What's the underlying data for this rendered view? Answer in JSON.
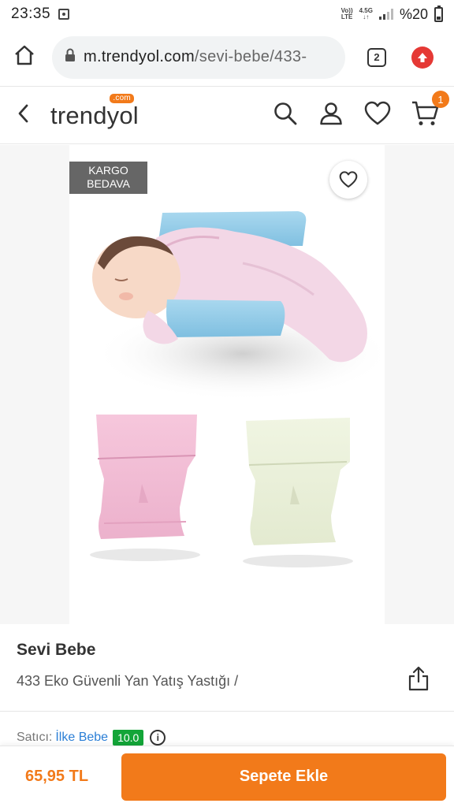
{
  "status_bar": {
    "time": "23:35",
    "network_top": "Vo))",
    "network_bottom": "LTE",
    "speed_top": "4.5G",
    "speed_bottom": "↓↑",
    "battery": "%20"
  },
  "browser": {
    "url_domain": "m.trendyol.com",
    "url_path": "/sevi-bebe/433-",
    "tab_count": "2"
  },
  "header": {
    "logo": "trendyol",
    "logo_suffix": ".com",
    "cart_count": "1"
  },
  "product": {
    "badge_line1": "KARGO",
    "badge_line2": "BEDAVA",
    "brand": "Sevi Bebe",
    "name": "433 Eko Güvenli Yan Yatış Yastığı /",
    "seller_label": "Satıcı:",
    "seller_name": "İlke Bebe",
    "seller_score": "10.0",
    "info_icon": "i"
  },
  "bottom_bar": {
    "price": "65,95 TL",
    "add_to_cart": "Sepete Ekle"
  },
  "colors": {
    "accent": "#f27a1a",
    "seller_link": "#2b7fd6",
    "score_green": "#13a538"
  }
}
